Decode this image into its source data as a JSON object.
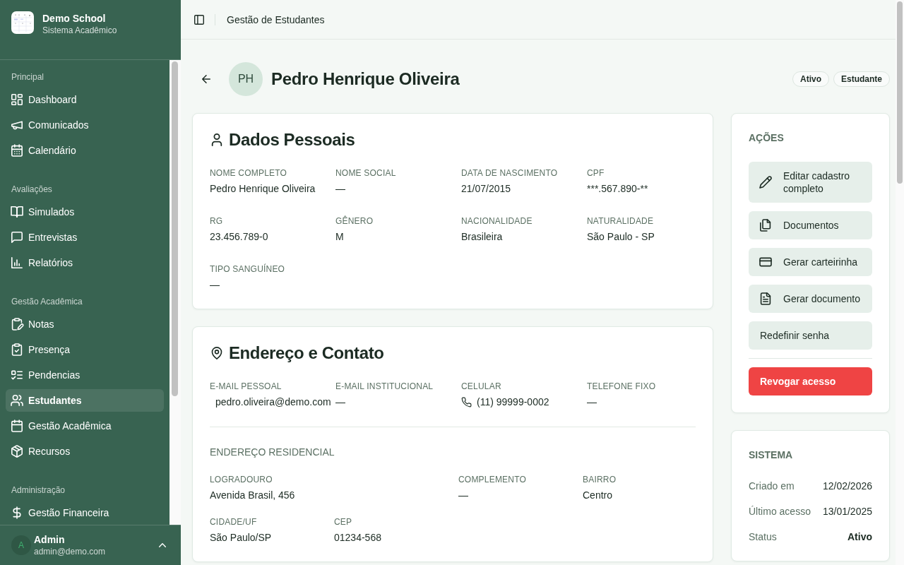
{
  "sidebar": {
    "brand": {
      "name": "Demo School",
      "subtitle": "Sistema Acadêmico"
    },
    "sections": [
      {
        "title": "Principal",
        "items": [
          {
            "label": "Dashboard",
            "selected": false
          },
          {
            "label": "Comunicados",
            "selected": false
          },
          {
            "label": "Calendário",
            "selected": false
          }
        ]
      },
      {
        "title": "Avaliações",
        "items": [
          {
            "label": "Simulados",
            "selected": false
          },
          {
            "label": "Entrevistas",
            "selected": false
          },
          {
            "label": "Relatórios",
            "selected": false
          }
        ]
      },
      {
        "title": "Gestão Acadêmica",
        "items": [
          {
            "label": "Notas",
            "selected": false
          },
          {
            "label": "Presença",
            "selected": false
          },
          {
            "label": "Pendencias",
            "selected": false
          },
          {
            "label": "Estudantes",
            "selected": true
          },
          {
            "label": "Gestão Acadêmica",
            "selected": false
          },
          {
            "label": "Recursos",
            "selected": false
          }
        ]
      },
      {
        "title": "Administração",
        "items": [
          {
            "label": "Gestão Financeira",
            "selected": false
          }
        ]
      }
    ],
    "user": {
      "initial": "A",
      "name": "Admin",
      "email": "admin@demo.com"
    }
  },
  "header": {
    "title": "Gestão de Estudantes"
  },
  "profile": {
    "initials": "PH",
    "name": "Pedro Henrique Oliveira",
    "tags": [
      "Ativo",
      "Estudante"
    ]
  },
  "personal_data": {
    "title": "Dados Pessoais",
    "fields": [
      {
        "label": "NOME COMPLETO",
        "value": "Pedro Henrique Oliveira"
      },
      {
        "label": "NOME SOCIAL",
        "value": "—"
      },
      {
        "label": "DATA DE NASCIMENTO",
        "value": "21/07/2015"
      },
      {
        "label": "CPF",
        "value": "***.567.890-**"
      },
      {
        "label": "RG",
        "value": "23.456.789-0"
      },
      {
        "label": "GÊNERO",
        "value": "M"
      },
      {
        "label": "NACIONALIDADE",
        "value": "Brasileira"
      },
      {
        "label": "NATURALIDADE",
        "value": "São Paulo - SP"
      },
      {
        "label": "TIPO SANGUÍNEO",
        "value": "—"
      }
    ]
  },
  "address_contact": {
    "title": "Endereço e Contato",
    "contact_fields": [
      {
        "label": "E-MAIL PESSOAL",
        "value": "pedro.oliveira@demo.com",
        "kind": "email"
      },
      {
        "label": "E-MAIL INSTITUCIONAL",
        "value": "—",
        "kind": "text"
      },
      {
        "label": "CELULAR",
        "value": "(11) 99999-0002",
        "kind": "phone"
      },
      {
        "label": "TELEFONE FIXO",
        "value": "—",
        "kind": "text"
      }
    ],
    "address_title": "ENDEREÇO RESIDENCIAL",
    "address_fields": [
      {
        "label": "LOGRADOURO",
        "value": "Avenida Brasil, 456"
      },
      {
        "label": "COMPLEMENTO",
        "value": "—"
      },
      {
        "label": "BAIRRO",
        "value": "Centro"
      },
      {
        "label": "CIDADE/UF",
        "value": "São Paulo/SP"
      },
      {
        "label": "CEP",
        "value": "01234-568"
      }
    ]
  },
  "actions": {
    "title": "AÇÕES",
    "buttons": [
      {
        "label": "Editar cadastro completo",
        "kind": "secondary"
      },
      {
        "label": "Documentos",
        "kind": "secondary"
      },
      {
        "label": "Gerar carteirinha",
        "kind": "secondary"
      },
      {
        "label": "Gerar documento",
        "kind": "secondary"
      },
      {
        "label": "Redefinir senha",
        "kind": "secondary"
      },
      {
        "label": "Revogar acesso",
        "kind": "danger"
      }
    ]
  },
  "system": {
    "title": "SISTEMA",
    "rows": [
      {
        "label": "Criado em",
        "value": "12/02/2026",
        "kind": "text"
      },
      {
        "label": "Último acesso",
        "value": "13/01/2025",
        "kind": "text"
      },
      {
        "label": "Status",
        "value": "Ativo",
        "kind": "status"
      }
    ]
  }
}
